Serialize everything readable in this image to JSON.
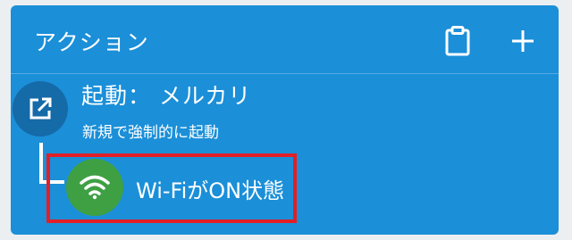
{
  "header": {
    "title": "アクション",
    "clipboard_icon": "clipboard-icon",
    "add_icon": "plus-icon"
  },
  "action": {
    "icon": "open-external-icon",
    "title": "起動： メルカリ",
    "subtitle": "新規で強制的に起動"
  },
  "constraint": {
    "icon": "wifi-icon",
    "label": "Wi-FiがON状態",
    "highlight_color": "#e21f26",
    "icon_bg": "#3ea043"
  },
  "colors": {
    "card_bg": "#1b8fd8",
    "action_icon_bg": "#156aa8"
  }
}
